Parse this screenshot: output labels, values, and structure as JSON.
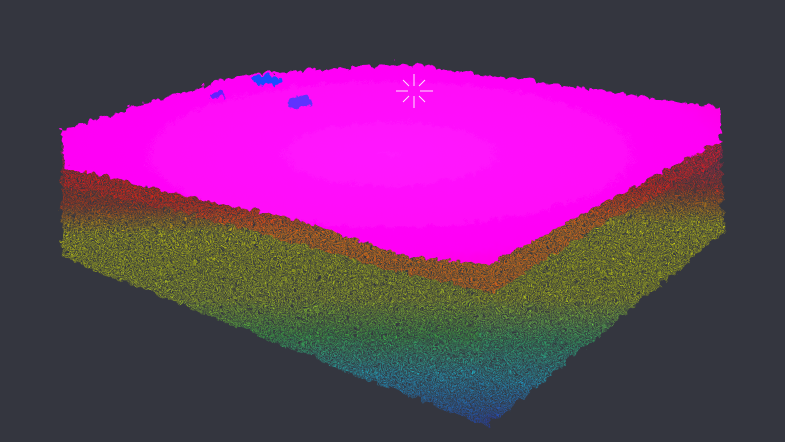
{
  "viewer": {
    "background_color": "#34363f",
    "view": "3d-perspective",
    "content": "point-cloud",
    "height_color_ramp": [
      "#1e3cff",
      "#14d8ff",
      "#2ee87a",
      "#d6ff12",
      "#ffff00",
      "#ff1010",
      "#ff00cc",
      "#ff00ff"
    ],
    "rotation_center_color": "#ffffff",
    "rotation_center_icon": "crosshair-icon"
  }
}
